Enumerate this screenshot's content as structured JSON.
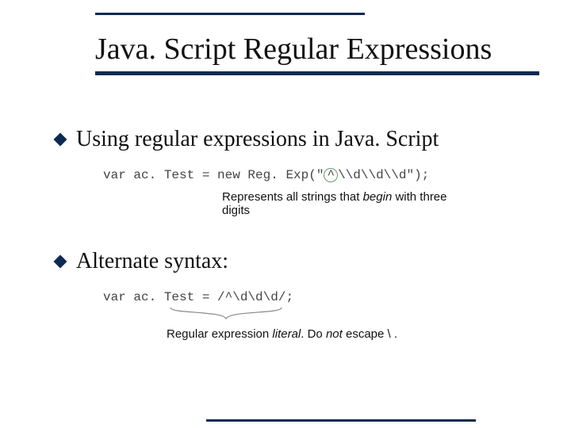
{
  "title": "Java. Script Regular Expressions",
  "bullet1": "Using regular expressions in Java. Script",
  "code1_pre": "var ac. Test = new Reg. Exp(\"",
  "code1_caret": "^",
  "code1_post": "\\\\d\\\\d\\\\d\");",
  "annot1_a": "Represents all strings that ",
  "annot1_b": "begin",
  "annot1_c": " with three digits",
  "bullet2": "Alternate syntax:",
  "code2": "var ac. Test = /^\\d\\d\\d/;",
  "annot2_a": "Regular expression ",
  "annot2_b": "literal",
  "annot2_c": ". Do ",
  "annot2_d": "not",
  "annot2_e": " escape \\ ."
}
